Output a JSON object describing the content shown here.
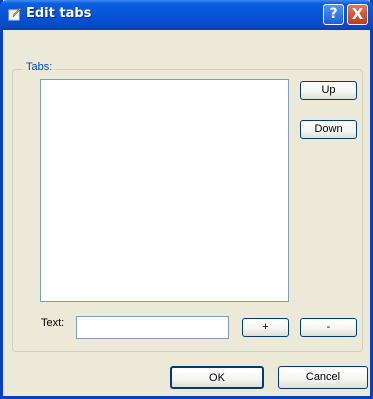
{
  "window": {
    "title": "Edit tabs",
    "help_label": "?",
    "close_label": "X"
  },
  "group": {
    "label": "Tabs:"
  },
  "list": {
    "items": []
  },
  "buttons": {
    "up": "Up",
    "down": "Down",
    "add": "+",
    "remove": "-",
    "ok": "OK",
    "cancel": "Cancel"
  },
  "text_field": {
    "label": "Text:",
    "value": ""
  },
  "icons": {
    "title_icon": "edit-pencil-icon"
  },
  "colors": {
    "titlebar": "#0653d6",
    "dialog_bg": "#ece9d8",
    "group_label": "#0046d5",
    "close": "#c3391a"
  }
}
